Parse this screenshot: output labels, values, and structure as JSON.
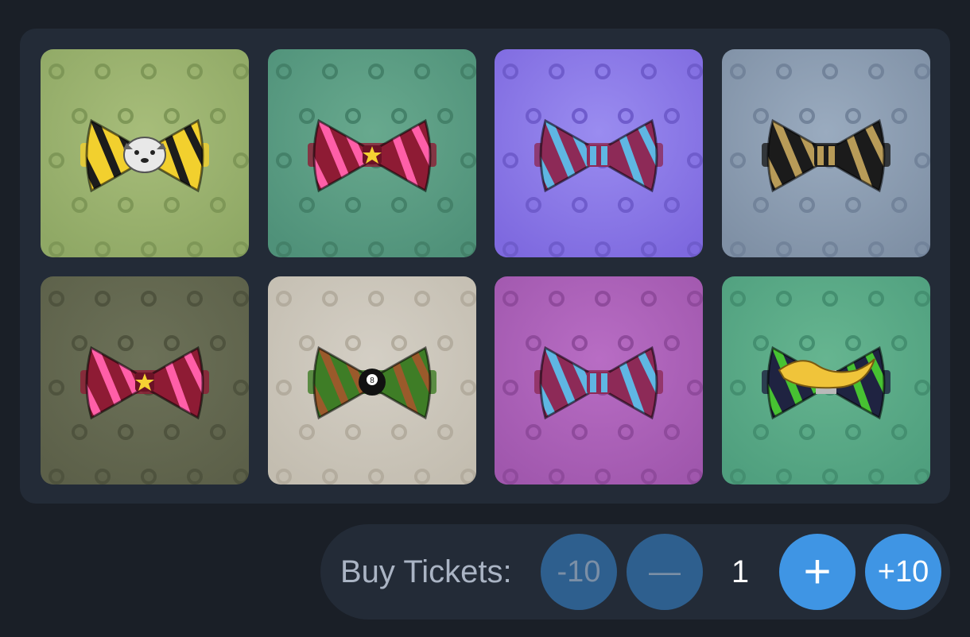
{
  "gallery": {
    "items": [
      {
        "name": "yellow-striped-bowtie",
        "bg": "#8fa865",
        "bg_light": "#a7bd7a",
        "pattern": "#7e9757",
        "bow": "#f2d02e",
        "stripe": "#1c1c1c",
        "center": "face"
      },
      {
        "name": "cherry-bowtie-teal",
        "bg": "#4f9179",
        "bg_light": "#68a98e",
        "pattern": "#448169",
        "bow": "#8e1b34",
        "stripe": "#ff5fa8",
        "center": "star"
      },
      {
        "name": "blue-maroon-striped-bowtie-purple",
        "bg": "#7e69df",
        "bg_light": "#9a8cf0",
        "pattern": "#6f5ccc",
        "bow": "#8d2a57",
        "stripe": "#5fb6e3",
        "center": "plain"
      },
      {
        "name": "black-gold-bowtie",
        "bg": "#7f90a5",
        "bg_light": "#9aabbf",
        "pattern": "#72839a",
        "bow": "#1b1b1b",
        "stripe": "#b89b58",
        "center": "plain"
      },
      {
        "name": "cherry-bowtie-olive",
        "bg": "#5c6049",
        "bg_light": "#6c7158",
        "pattern": "#4f533e",
        "bow": "#8e1b34",
        "stripe": "#ff5fa8",
        "center": "star"
      },
      {
        "name": "eight-ball-bowtie",
        "bg": "#c3bdb0",
        "bg_light": "#d4cfc5",
        "pattern": "#b3ac9e",
        "bow": "#3e7d26",
        "stripe": "#9a5a2b",
        "center": "eightball"
      },
      {
        "name": "blue-maroon-striped-bowtie-magenta",
        "bg": "#a057ad",
        "bg_light": "#b86dc4",
        "pattern": "#8f4a9c",
        "bow": "#8d2a57",
        "stripe": "#5fb6e3",
        "center": "plain"
      },
      {
        "name": "banana-splatter-bowtie",
        "bg": "#4f9f7e",
        "bg_light": "#66b590",
        "pattern": "#448f70",
        "bow": "#1f2341",
        "stripe": "#47c232",
        "center": "banana"
      }
    ]
  },
  "purchase": {
    "label": "Buy Tickets:",
    "minus_ten_label": "-10",
    "minus_label": "—",
    "quantity": "1",
    "plus_label": "+",
    "plus_ten_label": "+10"
  }
}
